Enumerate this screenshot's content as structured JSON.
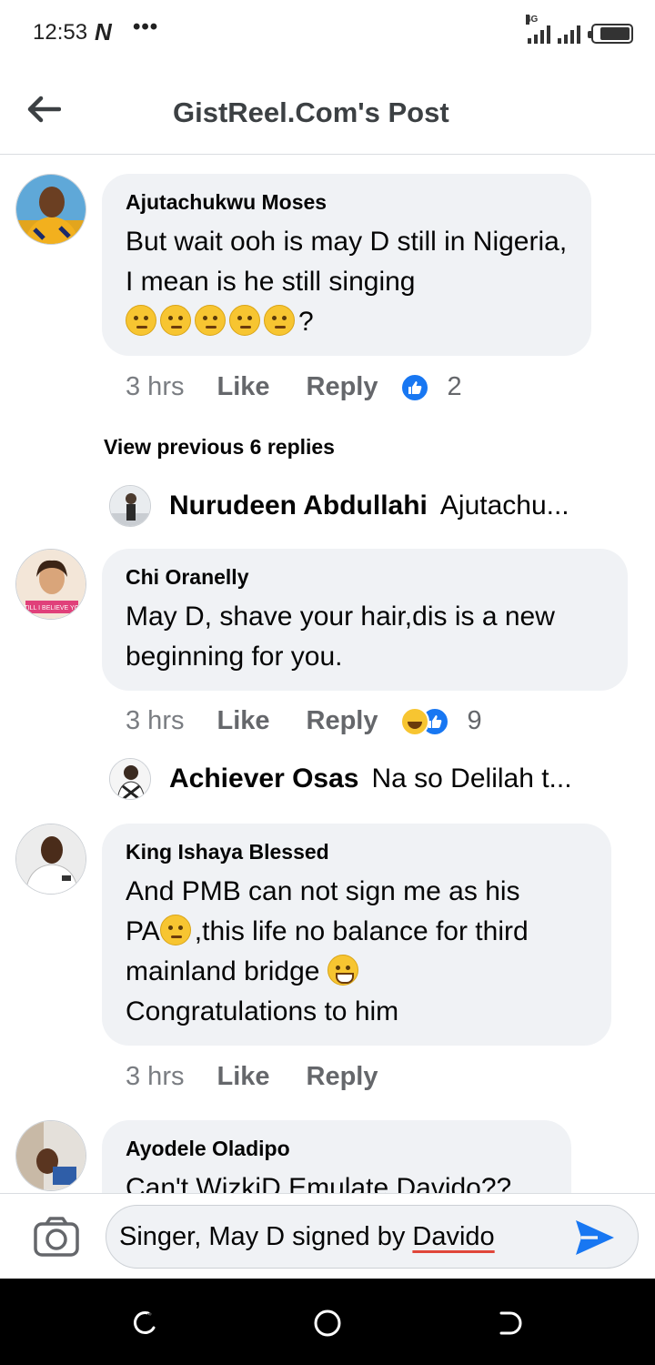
{
  "status_bar": {
    "time": "12:53",
    "carrier_icon": "N",
    "more": "•••",
    "network": "4G"
  },
  "header": {
    "title": "GistReel.Com's Post"
  },
  "comments": [
    {
      "author": "Ajutachukwu Moses",
      "text": "But wait ooh is may D still in Nigeria, I mean is he still singing",
      "trailing": "?",
      "time": "3 hrs",
      "like_label": "Like",
      "reply_label": "Reply",
      "reaction_count": "2"
    },
    {
      "author": "Chi Oranelly",
      "text": "May D, shave your hair,dis is a new beginning for you.",
      "time": "3 hrs",
      "like_label": "Like",
      "reply_label": "Reply",
      "reaction_count": "9"
    },
    {
      "author": "King Ishaya Blessed",
      "text_line1": "And PMB can not sign me as his",
      "text_line2a": "PA",
      "text_line2b": ",this life no balance for third",
      "text_line3": "mainland bridge ",
      "text_line4": "Congratulations to him",
      "time": "3 hrs",
      "like_label": "Like",
      "reply_label": "Reply"
    },
    {
      "author": "Ayodele Oladipo",
      "text": "Can't WizkiD Emulate Davido??"
    }
  ],
  "view_previous": "View previous 6 replies",
  "replies": [
    {
      "name": "Nurudeen Abdullahi",
      "preview": "Ajutachu..."
    },
    {
      "name": "Achiever Osas",
      "preview": "Na so Delilah t..."
    }
  ],
  "composer": {
    "text_before": "Singer, May D signed by ",
    "text_underlined": "Davido"
  },
  "colors": {
    "accent": "#1877f2",
    "bubble": "#f0f2f5",
    "muted": "#65676b"
  }
}
